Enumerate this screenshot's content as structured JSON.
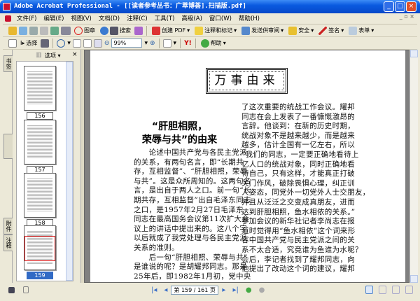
{
  "window": {
    "title": "Adobe Acrobat Professional - [[读者参考丛书：广萃博荟].扫描版.pdf]"
  },
  "menu": [
    "文件(F)",
    "编辑(E)",
    "视图(V)",
    "文档(D)",
    "注释(C)",
    "工具(T)",
    "高级(A)",
    "窗口(W)",
    "帮助(H)"
  ],
  "toolbar1": {
    "stamp": "图章",
    "search": "搜索",
    "create_pdf": "创建 PDF",
    "comment": "注释和标记",
    "send_review": "发送供审阅",
    "security": "安全",
    "sign": "签名",
    "forms": "表单"
  },
  "toolbar2": {
    "select": "选择",
    "zoom_value": "99%",
    "help": "帮助"
  },
  "sidebar": {
    "options": "选项",
    "close": "×",
    "tabs": [
      "书签",
      "签名",
      "附件",
      "注释"
    ],
    "pages": [
      "156",
      "157",
      "158",
      "159"
    ],
    "selected": "159"
  },
  "document": {
    "header": "万事由来",
    "title1": "“肝胆相照，",
    "title2": "荣辱与共”的由来",
    "left_col": [
      "　　论述中国共产党与各民主党派",
      "的关系，有两句名言，即“长期共",
      "存，互相监督”、“肝胆相照，荣辱",
      "与共”。这是众所周知的。这两句名",
      "言，是出自于两人之口。前一句“长",
      "期共存，互相监督”出自毛泽东同志",
      "之口，是1957年2月27日毛泽东",
      "同志在最高国务会议第11次扩大会",
      "议上的讲话中提出来的。这八个字",
      "以后就成了我党处理与各民主党派",
      "关系的准则。",
      "　　后一句“肝胆相照、荣辱与共”",
      "是谁说的呢？是胡耀邦同志。那是",
      "25年后，即1982年1月初，党中央"
    ],
    "right_col": [
      "了这次重要的统战工作会议。耀邦",
      "同志在会上发表了一番慷慨激昂的",
      "言辞。他谈到：在新的历史时期，",
      "统战对象不是越来越少，而是越来",
      "越多，估计全国有一亿左右，所以",
      "“我们的同志，一定要正确地看待上",
      "亿人口的统战对象，同时正确地看",
      "待自己，只有这样，才能真正打破",
      "关门作风，破除畏惧心理，纠正训",
      "人姿态，同党外一切党外人士交朋友，",
      "并且从泛泛之交变成真朋友，进而",
      "达到肝胆相照，鱼水相依的关系。”",
      "参加会议的新华社记者李尚志在报",
      "道时觉得用“鱼水相依”这个词来形",
      "容中国共产党与民主党派之间的关",
      "系不太合适，究竟谁为鱼谁为水呢？",
      "会后，李记者找到了耀邦同志，向",
      "他提出了改动这个词的建议，耀邦"
    ]
  },
  "status": {
    "page_indicator": "第 159 / 161 页"
  }
}
